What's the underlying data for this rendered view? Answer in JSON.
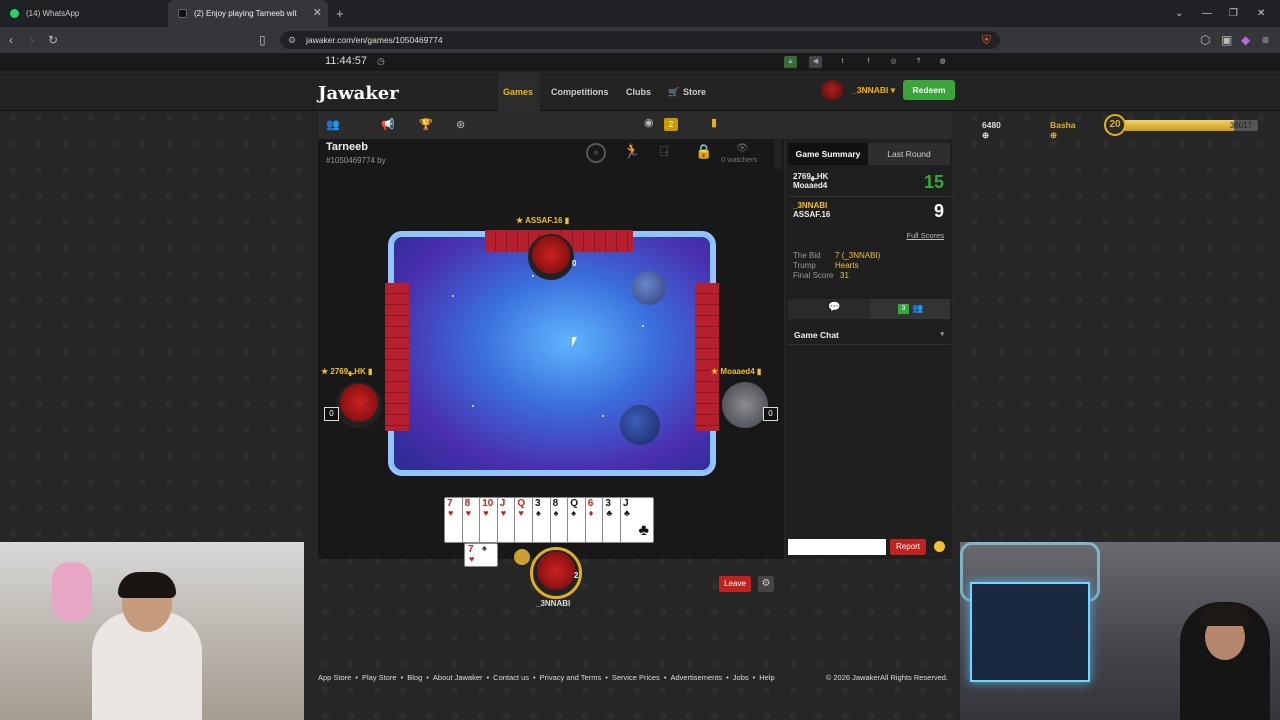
{
  "browser": {
    "tabs": [
      {
        "title": "(14) WhatsApp"
      },
      {
        "title": "(2) Enjoy playing Tarneeb wit"
      }
    ],
    "new_tab": "+",
    "url": "jawaker.com/en/games/1050469774"
  },
  "site": {
    "clock": "11:44:57",
    "logo": "Jawaker",
    "nav": {
      "games": "Games",
      "competitions": "Competitions",
      "clubs": "Clubs",
      "store": "Store"
    },
    "username": "_3NNABI",
    "redeem": "Redeem",
    "friends_count": "2",
    "coins": "6480",
    "rank": "Basha",
    "level": "20",
    "xp": "36017",
    "xp_progress": 0.82
  },
  "game": {
    "title": "Tarneeb",
    "id_line": "#1050469774 by",
    "watchers": "0 watchers",
    "players": {
      "top": {
        "name": "ASSAF.16",
        "score": "0"
      },
      "left": {
        "name": "2769ـ‍ه‍HK",
        "score": "0"
      },
      "right": {
        "name": "Moaaed4",
        "score": "0"
      },
      "bottom": {
        "name": "_3NNABI",
        "score": "2"
      }
    },
    "hand": [
      {
        "rank": "7",
        "suit": "♥",
        "color": "#c0221e"
      },
      {
        "rank": "8",
        "suit": "♥",
        "color": "#c0221e"
      },
      {
        "rank": "10",
        "suit": "♥",
        "color": "#c0221e"
      },
      {
        "rank": "J",
        "suit": "♥",
        "color": "#c0221e"
      },
      {
        "rank": "Q",
        "suit": "♥",
        "color": "#c0221e"
      },
      {
        "rank": "3",
        "suit": "♠",
        "color": "#111111"
      },
      {
        "rank": "8",
        "suit": "♠",
        "color": "#111111"
      },
      {
        "rank": "Q",
        "suit": "♠",
        "color": "#111111"
      },
      {
        "rank": "6",
        "suit": "♦",
        "color": "#c0221e"
      },
      {
        "rank": "3",
        "suit": "♣",
        "color": "#111111"
      },
      {
        "rank": "J",
        "suit": "♣",
        "color": "#111111"
      }
    ],
    "played_card": {
      "rank": "7",
      "suit": "♥"
    },
    "leave": "Leave"
  },
  "summary": {
    "tab_summary": "Game Summary",
    "tab_last": "Last Round",
    "teams": [
      {
        "p1": "2769ـ‍ه‍HK",
        "p2": "Moaaed4",
        "score": "15",
        "color": "#3aa53a"
      },
      {
        "p1": "_3NNABI",
        "p2": "ASSAF.16",
        "score": "9",
        "color": "#ffffff"
      }
    ],
    "full_scores": "Full Scores",
    "bid_label": "The Bid",
    "bid_value": "7 (_3NNABI)",
    "trump_label": "Trump",
    "trump_value": "Hearts",
    "final_label": "Final Score",
    "final_value": "31",
    "online_count": "3",
    "chat_title": "Game Chat",
    "report": "Report"
  },
  "footer": {
    "links": [
      "App Store",
      "Play Store",
      "Blog",
      "About Jawaker",
      "Contact us",
      "Privacy and Terms",
      "Service Prices",
      "Advertisements",
      "Jobs",
      "Help"
    ],
    "copyright": "© 2026 JawakerAll Rights Reserved."
  }
}
